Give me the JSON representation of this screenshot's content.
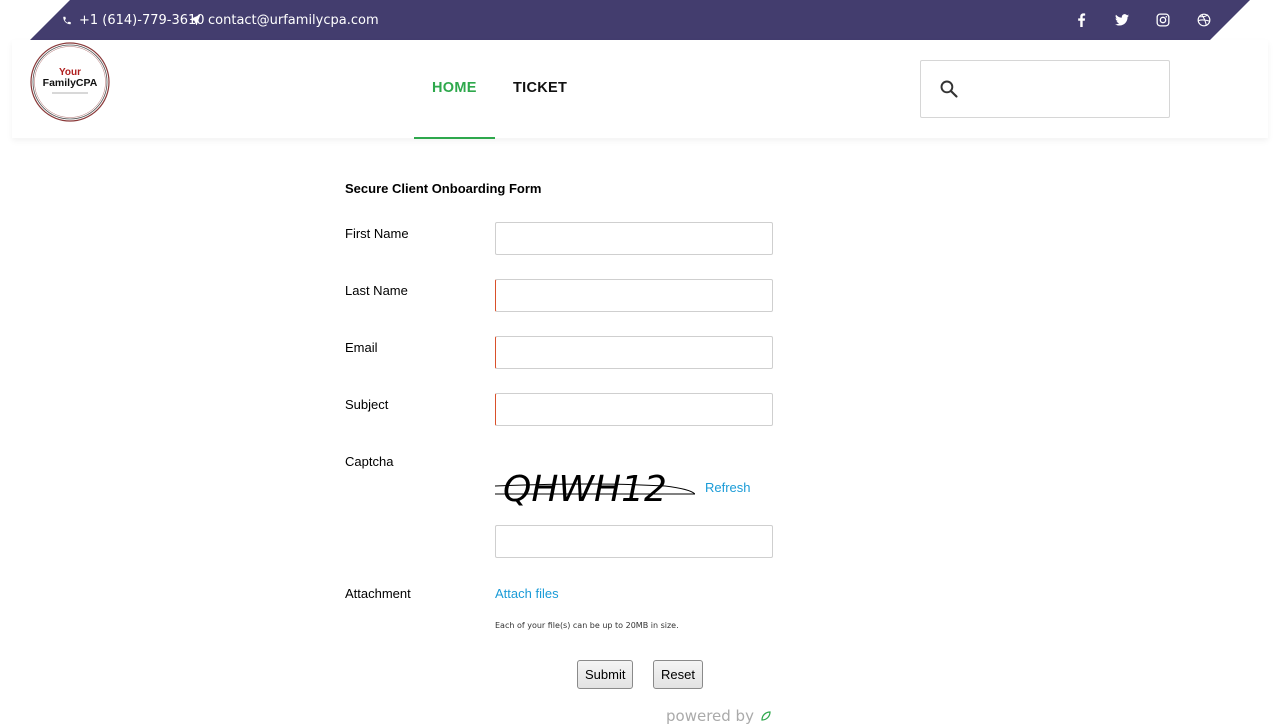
{
  "topbar": {
    "phone": "+1 (614)-779-3610",
    "email": "contact@urfamilycpa.com",
    "bar_color": "#433d6e",
    "social_icons": [
      "facebook-icon",
      "twitter-icon",
      "instagram-icon",
      "dribbble-icon"
    ]
  },
  "logo": {
    "line1": "Your",
    "line2": "FamilyCPA",
    "accent_color": "#b02020"
  },
  "nav": {
    "items": [
      {
        "label": "HOME",
        "active": true
      },
      {
        "label": "TICKET",
        "active": false
      }
    ],
    "active_color": "#2ea84c"
  },
  "search": {
    "placeholder": "",
    "value": ""
  },
  "form": {
    "title": "Secure Client Onboarding Form",
    "fields": [
      {
        "label": "First Name",
        "value": ""
      },
      {
        "label": "Last Name",
        "value": ""
      },
      {
        "label": "Email",
        "value": ""
      },
      {
        "label": "Subject",
        "value": ""
      },
      {
        "label": "Captcha",
        "value": ""
      },
      {
        "label": "Attachment",
        "value": ""
      }
    ],
    "captcha_text": "QHWH12",
    "refresh_label": "Refresh",
    "attach_label": "Attach files",
    "attach_hint": "Each of your file(s) can be up to 20MB in size.",
    "submit_label": "Submit",
    "reset_label": "Reset",
    "powered_by": "powered by",
    "link_color": "#1a9bd7"
  }
}
